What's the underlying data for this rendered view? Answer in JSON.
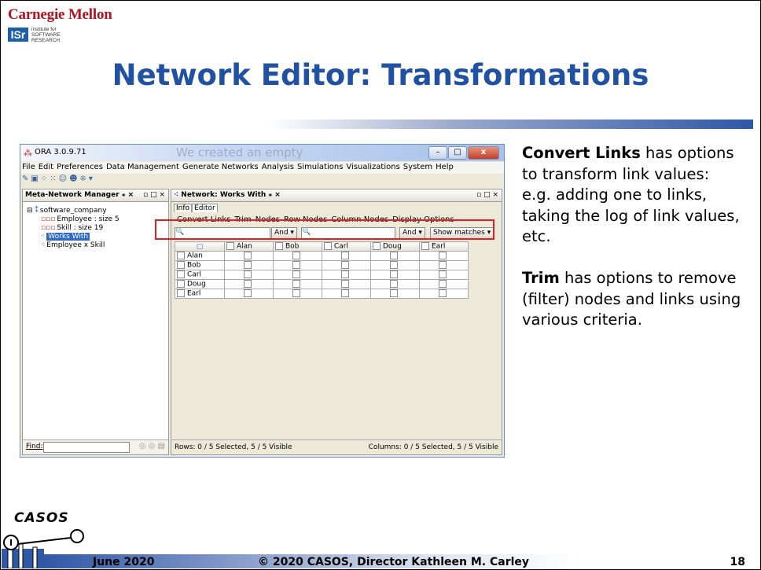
{
  "header": {
    "org": "Carnegie Mellon",
    "logo_abbr": "ISr",
    "logo_lines": [
      "institute for",
      "SOFTWARE",
      "RESEARCH"
    ],
    "title": "Network Editor: Transformations"
  },
  "app": {
    "window_title": "ORA 3.0.9.71",
    "ghost_text": "We created an empty",
    "window_buttons": [
      "–",
      "□",
      "x"
    ],
    "menu": [
      "File",
      "Edit",
      "Preferences",
      "Data Management",
      "Generate Networks",
      "Analysis",
      "Simulations",
      "Visualizations",
      "System",
      "Help"
    ],
    "left_pane": {
      "title": "Meta-Network Manager",
      "pin": "⁎ ×",
      "controls": "▫ □ ×",
      "root": "software_company",
      "items": [
        "Employee : size 5",
        "Skill : size 19",
        "Works With",
        "Employee x Skill"
      ],
      "find_label": "Find:"
    },
    "right_pane": {
      "title": "Network: Works With",
      "pin": "⁎ ×",
      "controls": "▫ □ ×",
      "tabs": [
        "Info",
        "Editor"
      ],
      "menu": [
        "Convert Links",
        "Trim",
        "Nodes",
        "Row Nodes",
        "Column Nodes",
        "Display Options"
      ],
      "filter_and_1": "And ▾",
      "filter_and_2": "And ▾",
      "show_matches": "Show matches ▾",
      "columns": [
        "Alan",
        "Bob",
        "Carl",
        "Doug",
        "Earl"
      ],
      "rows": [
        "Alan",
        "Bob",
        "Carl",
        "Doug",
        "Earl"
      ],
      "status_rows": "Rows: 0 / 5 Selected, 5 / 5 Visible",
      "status_cols": "Columns: 0 / 5 Selected, 5 / 5 Visible"
    }
  },
  "description": {
    "p1_bold": "Convert Links",
    "p1_rest": " has options to transform link values: e.g. adding one to links, taking the log of link values, etc.",
    "p2_bold": "Trim",
    "p2_rest": " has options to remove (filter) nodes and links using various criteria."
  },
  "footer": {
    "logo": "CASOS",
    "date": "June 2020",
    "copyright": "© 2020 CASOS, Director Kathleen M. Carley",
    "page": "18"
  }
}
